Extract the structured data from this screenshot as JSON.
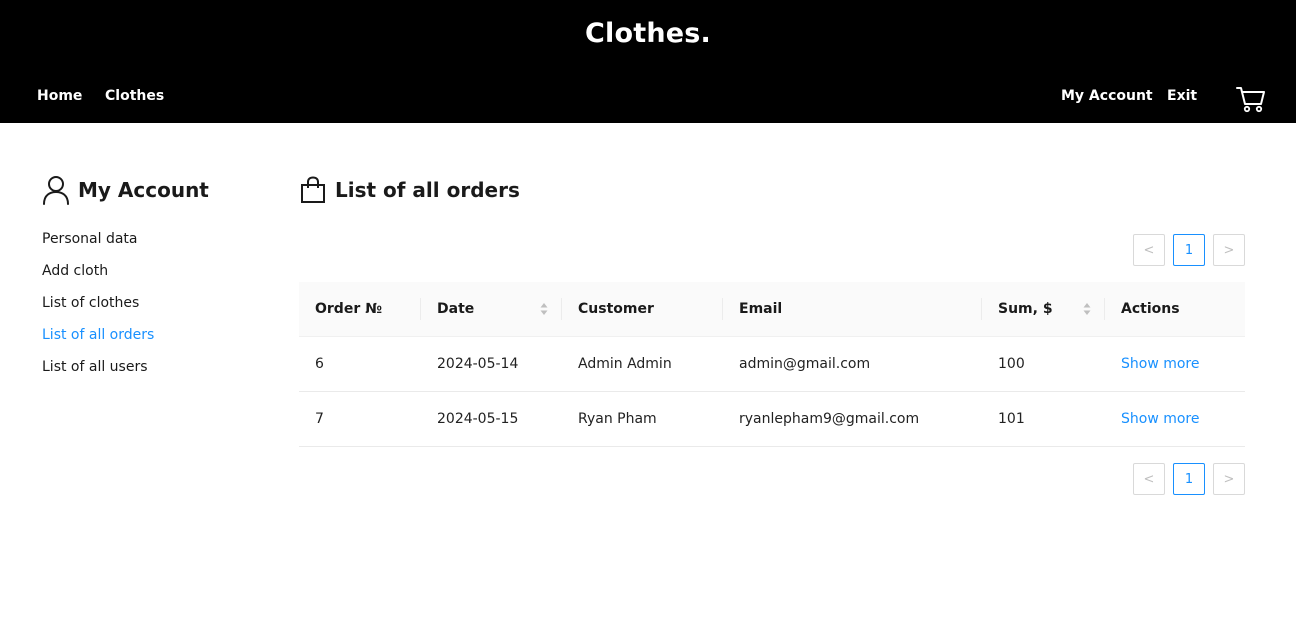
{
  "header": {
    "brand": "Clothes.",
    "nav": {
      "home": "Home",
      "clothes": "Clothes",
      "account": "My Account",
      "exit": "Exit"
    },
    "cart_icon": "cart-icon"
  },
  "sidebar": {
    "title": "My Account",
    "icon": "user-icon",
    "items": [
      {
        "label": "Personal data"
      },
      {
        "label": "Add cloth"
      },
      {
        "label": "List of clothes"
      },
      {
        "label": "List of all orders",
        "active": true
      },
      {
        "label": "List of all users"
      }
    ]
  },
  "main": {
    "title": "List of all orders",
    "icon": "shopping-bag-icon",
    "pagination": {
      "current": "1",
      "prev": "<",
      "next": ">"
    },
    "table": {
      "columns": [
        "Order №",
        "Date",
        "Customer",
        "Email",
        "Sum, $",
        "Actions"
      ],
      "rows": [
        {
          "order": "6",
          "date": "2024-05-14",
          "customer": "Admin Admin",
          "email": "admin@gmail.com",
          "sum": "100",
          "action": "Show more"
        },
        {
          "order": "7",
          "date": "2024-05-15",
          "customer": "Ryan Pham",
          "email": "ryanlepham9@gmail.com",
          "sum": "101",
          "action": "Show more"
        }
      ]
    }
  },
  "colors": {
    "header_bg": "#000000",
    "accent": "#1890ff",
    "table_header_bg": "#fafafa"
  }
}
